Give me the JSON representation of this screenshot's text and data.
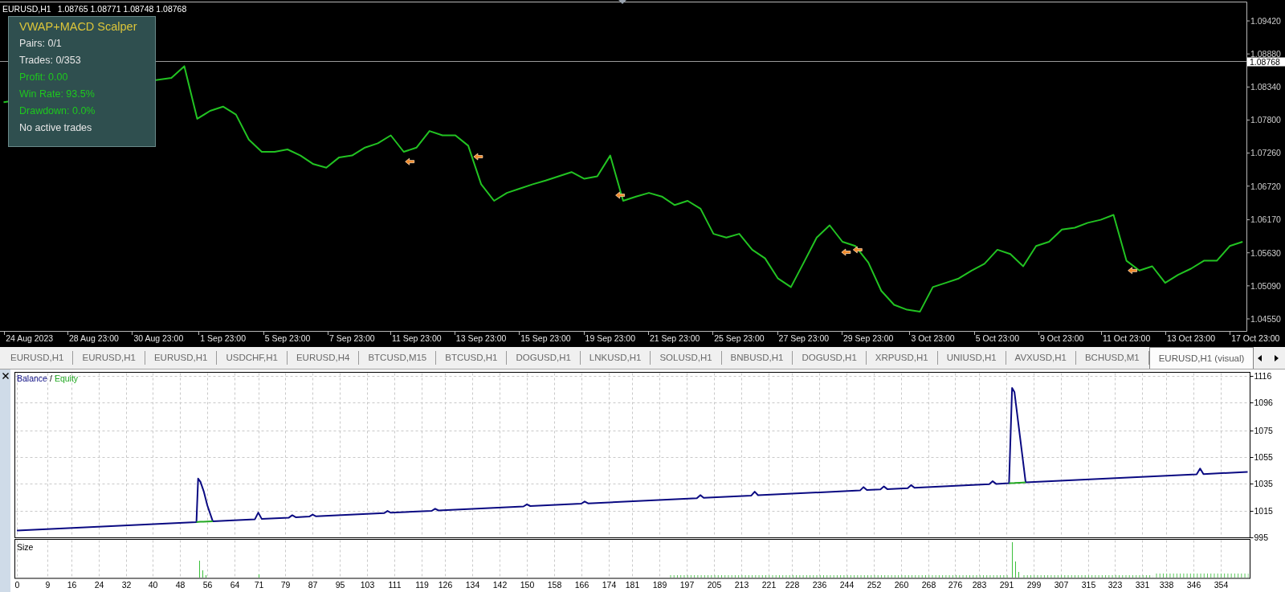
{
  "price_chart": {
    "symbol": "EURUSD,H1",
    "quote": "1.08765 1.08771 1.08748 1.08768",
    "chart_data": {
      "type": "line",
      "categories": [
        null,
        null,
        "24 Aug 2023",
        null,
        null,
        null,
        null,
        "28 Aug 23:00",
        null,
        null,
        null,
        null,
        "30 Aug 23:00",
        null,
        null,
        null,
        null,
        "1 Sep 23:00",
        null,
        null,
        null,
        null,
        "5 Sep 23:00",
        null,
        null,
        null,
        null,
        "7 Sep 23:00",
        null,
        null,
        null,
        null,
        "11 Sep 23:00",
        null,
        null,
        null,
        null,
        "13 Sep 23:00",
        null,
        null,
        null,
        null,
        "15 Sep 23:00",
        null,
        null,
        null,
        null,
        "19 Sep 23:00",
        null,
        null,
        null,
        null,
        "21 Sep 23:00",
        null,
        null,
        null,
        null,
        "25 Sep 23:00",
        null,
        null,
        null,
        null,
        "27 Sep 23:00",
        null,
        null,
        null,
        null,
        "29 Sep 23:00",
        null,
        null,
        null,
        null,
        "3 Oct 23:00",
        null,
        null,
        null,
        null,
        "5 Oct 23:00",
        null,
        null,
        null,
        null,
        "9 Oct 23:00",
        null,
        null,
        null,
        null,
        "11 Oct 23:00",
        null,
        null,
        null,
        null,
        "13 Oct 23:00",
        null,
        null,
        null,
        null,
        "17 Oct 23:00"
      ],
      "values": [
        1.0809,
        null,
        null,
        null,
        null,
        null,
        null,
        null,
        null,
        null,
        null,
        null,
        1.0846,
        1.0849,
        1.0868,
        1.0782,
        1.0795,
        1.0802,
        1.0789,
        1.0748,
        1.0728,
        1.0728,
        1.0732,
        1.0722,
        1.0708,
        1.0702,
        1.0719,
        1.0722,
        1.0735,
        1.0742,
        1.0755,
        1.0728,
        1.0735,
        1.0762,
        1.0755,
        1.0755,
        1.0738,
        1.0675,
        1.0648,
        1.0661,
        1.0668,
        1.0675,
        1.0681,
        1.0688,
        1.0695,
        1.0684,
        1.0688,
        1.0722,
        1.0648,
        1.0655,
        1.0661,
        1.0655,
        1.0641,
        1.0648,
        1.0635,
        1.0594,
        1.0588,
        1.0594,
        1.0568,
        1.0554,
        1.0521,
        1.0507,
        1.0547,
        1.0588,
        1.0608,
        1.0581,
        1.0574,
        1.0547,
        1.0501,
        1.0478,
        1.047,
        1.0467,
        1.0507,
        1.0514,
        1.0521,
        1.0534,
        1.0545,
        1.0568,
        1.0561,
        1.0541,
        1.0574,
        1.0581,
        1.0601,
        1.0604,
        1.0612,
        1.0617,
        1.0625,
        1.055,
        1.0534,
        1.0541,
        1.0514,
        1.0527,
        1.0537,
        1.055,
        1.055,
        1.0574,
        1.0581,
        null
      ],
      "ylim": [
        1.04353,
        1.09729
      ],
      "yticks": [
        {
          "value": 1.0942,
          "label": "1.09420"
        },
        {
          "value": 1.0888,
          "label": "1.08880"
        },
        {
          "value": 1.0834,
          "label": "1.08340"
        },
        {
          "value": 1.078,
          "label": "1.07800"
        },
        {
          "value": 1.0726,
          "label": "1.07260"
        },
        {
          "value": 1.0672,
          "label": "1.06720"
        },
        {
          "value": 1.0617,
          "label": "1.06170"
        },
        {
          "value": 1.0563,
          "label": "1.05630"
        },
        {
          "value": 1.0509,
          "label": "1.05090"
        },
        {
          "value": 1.0455,
          "label": "1.04550"
        }
      ],
      "ref_lines": [
        {
          "axis": "y",
          "value": 1.08768,
          "label": "1.08768"
        }
      ]
    }
  },
  "info_panel": {
    "title": "VWAP+MACD Scalper",
    "lines": [
      {
        "text": "Pairs: 0/1",
        "color": "#e6e6e6"
      },
      {
        "text": "Trades: 0/353",
        "color": "#e6e6e6"
      },
      {
        "text": "Profit: 0.00",
        "color": "#1ec81e"
      },
      {
        "text": "Win Rate: 93.5%",
        "color": "#1ec81e"
      },
      {
        "text": "Drawdown: 0.0%",
        "color": "#1ec81e"
      },
      {
        "text": "No active trades",
        "color": "#e6e6e6"
      }
    ]
  },
  "tabs": [
    {
      "label": "EURUSD,H1",
      "selected": false
    },
    {
      "label": "EURUSD,H1",
      "selected": false
    },
    {
      "label": "EURUSD,H1",
      "selected": false
    },
    {
      "label": "USDCHF,H1",
      "selected": false
    },
    {
      "label": "EURUSD,H4",
      "selected": false
    },
    {
      "label": "BTCUSD,M15",
      "selected": false
    },
    {
      "label": "BTCUSD,H1",
      "selected": false
    },
    {
      "label": "DOGUSD,H1",
      "selected": false
    },
    {
      "label": "LNKUSD,H1",
      "selected": false
    },
    {
      "label": "SOLUSD,H1",
      "selected": false
    },
    {
      "label": "BNBUSD,H1",
      "selected": false
    },
    {
      "label": "DOGUSD,H1",
      "selected": false
    },
    {
      "label": "XRPUSD,H1",
      "selected": false
    },
    {
      "label": "UNIUSD,H1",
      "selected": false
    },
    {
      "label": "AVXUSD,H1",
      "selected": false
    },
    {
      "label": "BCHUSD,M1",
      "selected": false
    },
    {
      "label": "EURUSD,H1 (visual)",
      "selected": true
    }
  ],
  "tester": {
    "balance_panel": {
      "legend_separator": "/",
      "chart_data": {
        "type": "line",
        "grid": true,
        "x": [
          0,
          52.8,
          53.3,
          54,
          55,
          56,
          57.6,
          70,
          71,
          72,
          80,
          81,
          82,
          86,
          87,
          88,
          108,
          109,
          110,
          122,
          123,
          124,
          149,
          150,
          151,
          166,
          167,
          168,
          200,
          201,
          202,
          216,
          217,
          218,
          248,
          249,
          250,
          254,
          255,
          256,
          262,
          263,
          264,
          286,
          287,
          288,
          291.8,
          292.7,
          293.4,
          295,
          296.7,
          347,
          348,
          349,
          362
        ],
        "series": [
          {
            "name": "Balance",
            "color": "#0a0a82",
            "values": [
              1000,
              1006.4,
              1039,
              1036.5,
              1029,
              1019,
              1007,
              1008.5,
              1013.5,
              1008.8,
              1009.7,
              1011.5,
              1010,
              1010.5,
              1012,
              1010.7,
              1013.1,
              1014.7,
              1013.4,
              1014.8,
              1016.4,
              1015.1,
              1018.1,
              1019.7,
              1018.4,
              1020.2,
              1021.8,
              1020.4,
              1024.3,
              1026.6,
              1024.6,
              1026.3,
              1029.2,
              1026.5,
              1030.1,
              1032.6,
              1030.4,
              1030.9,
              1033.1,
              1031.1,
              1031.8,
              1034.1,
              1032.1,
              1034.8,
              1037,
              1035,
              1035.5,
              1107,
              1104,
              1071,
              1036.1,
              1042.2,
              1046.5,
              1042.4,
              1044
            ]
          },
          {
            "name": "Equity",
            "color": "#21a821",
            "values": [
              null,
              1006.4,
              1006.5,
              1006.6,
              1006.7,
              1006.8,
              1007,
              null,
              null,
              null,
              null,
              null,
              null,
              null,
              null,
              null,
              null,
              null,
              null,
              null,
              null,
              null,
              null,
              null,
              null,
              null,
              null,
              null,
              null,
              null,
              null,
              null,
              null,
              null,
              null,
              null,
              null,
              null,
              null,
              null,
              null,
              null,
              null,
              null,
              null,
              null,
              1035.5,
              1035.6,
              1035.7,
              1035.9,
              1036.1,
              null,
              null,
              null,
              null
            ]
          }
        ],
        "xlim": [
          -0.6,
          362.7
        ],
        "ylim": [
          994.6,
          1118.7
        ],
        "xticks": [
          0,
          9,
          16,
          24,
          32,
          40,
          48,
          56,
          64,
          71,
          79,
          87,
          95,
          103,
          111,
          119,
          126,
          134,
          142,
          150,
          158,
          166,
          174,
          181,
          189,
          197,
          205,
          213,
          221,
          228,
          236,
          244,
          252,
          260,
          268,
          276,
          283,
          291,
          299,
          307,
          315,
          323,
          331,
          338,
          346,
          354
        ],
        "yticks": [
          995,
          1015,
          1035,
          1055,
          1075,
          1096,
          1116
        ]
      }
    },
    "size_panel": {
      "label": "Size"
    }
  }
}
